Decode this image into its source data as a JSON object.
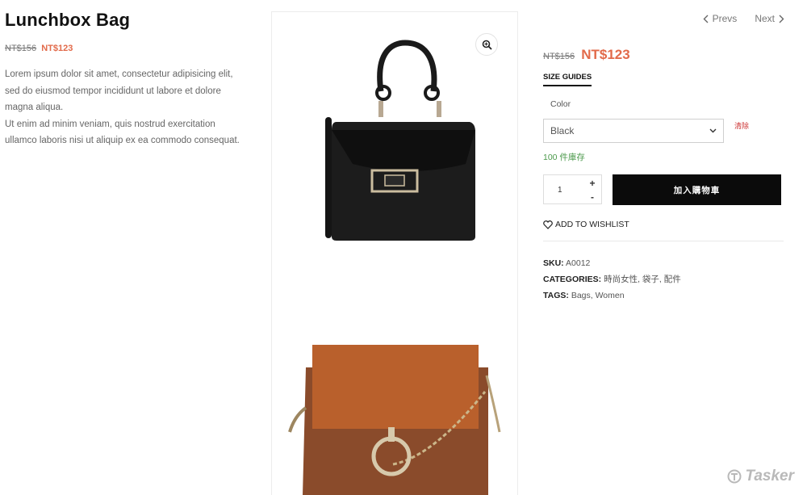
{
  "product": {
    "title": "Lunchbox Bag",
    "old_price": "NT$156",
    "new_price": "NT$123",
    "description": [
      "Lorem ipsum dolor sit amet, consectetur adipisicing elit,",
      "sed do eiusmod tempor incididunt ut labore et dolore",
      "magna aliqua.",
      "Ut enim ad minim veniam, quis nostrud exercitation",
      "ullamco laboris nisi ut aliquip ex ea commodo consequat."
    ]
  },
  "nav": {
    "prev": "Prevs",
    "next": "Next"
  },
  "options": {
    "size_guides": "SIZE GUIDES",
    "color_label": "Color",
    "color_value": "Black",
    "clear": "清除",
    "stock": "100 件庫存"
  },
  "cart": {
    "quantity": "1",
    "plus": "+",
    "minus": "-",
    "add_label": "加入購物車",
    "wishlist": "ADD TO WISHLIST"
  },
  "meta": {
    "sku_label": "SKU:",
    "sku": "A0012",
    "categories_label": "CATEGORIES:",
    "categories": "時尚女性, 袋子, 配件",
    "tags_label": "TAGS:",
    "tags": "Bags, Women"
  },
  "watermark": "Tasker",
  "colors": {
    "accent": "#e26a4a",
    "button": "#0b0b0b",
    "stock": "#4c9a4c"
  }
}
